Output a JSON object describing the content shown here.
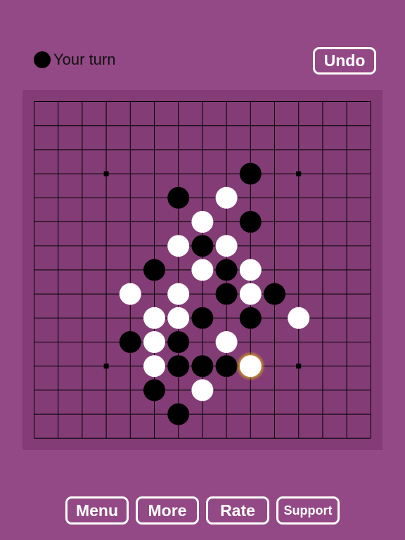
{
  "status": {
    "turn_text": "Your turn",
    "turn_color": "black"
  },
  "toolbar": {
    "undo_label": "Undo"
  },
  "footer": {
    "menu_label": "Menu",
    "more_label": "More",
    "rate_label": "Rate",
    "support_label": "Support"
  },
  "colors": {
    "background": "#934985",
    "board": "#833c75",
    "grid_line": "#000000",
    "black_stone": "#000000",
    "white_stone": "#ffffff",
    "last_move_glow": "#f2c200"
  },
  "board": {
    "size": 15,
    "star_points": [
      [
        3,
        3
      ],
      [
        11,
        3
      ],
      [
        3,
        11
      ],
      [
        11,
        11
      ]
    ],
    "last_move": [
      9,
      11
    ],
    "stones": [
      {
        "col": 9,
        "row": 3,
        "color": "black"
      },
      {
        "col": 6,
        "row": 4,
        "color": "black"
      },
      {
        "col": 8,
        "row": 4,
        "color": "white"
      },
      {
        "col": 7,
        "row": 5,
        "color": "white"
      },
      {
        "col": 9,
        "row": 5,
        "color": "black"
      },
      {
        "col": 6,
        "row": 6,
        "color": "white"
      },
      {
        "col": 7,
        "row": 6,
        "color": "black"
      },
      {
        "col": 8,
        "row": 6,
        "color": "white"
      },
      {
        "col": 5,
        "row": 7,
        "color": "black"
      },
      {
        "col": 7,
        "row": 7,
        "color": "white"
      },
      {
        "col": 8,
        "row": 7,
        "color": "black"
      },
      {
        "col": 9,
        "row": 7,
        "color": "white"
      },
      {
        "col": 4,
        "row": 8,
        "color": "white"
      },
      {
        "col": 6,
        "row": 8,
        "color": "white"
      },
      {
        "col": 8,
        "row": 8,
        "color": "black"
      },
      {
        "col": 9,
        "row": 8,
        "color": "white"
      },
      {
        "col": 10,
        "row": 8,
        "color": "black"
      },
      {
        "col": 5,
        "row": 9,
        "color": "white"
      },
      {
        "col": 6,
        "row": 9,
        "color": "white"
      },
      {
        "col": 7,
        "row": 9,
        "color": "black"
      },
      {
        "col": 9,
        "row": 9,
        "color": "black"
      },
      {
        "col": 11,
        "row": 9,
        "color": "white"
      },
      {
        "col": 4,
        "row": 10,
        "color": "black"
      },
      {
        "col": 5,
        "row": 10,
        "color": "white"
      },
      {
        "col": 6,
        "row": 10,
        "color": "black"
      },
      {
        "col": 8,
        "row": 10,
        "color": "white"
      },
      {
        "col": 5,
        "row": 11,
        "color": "white"
      },
      {
        "col": 6,
        "row": 11,
        "color": "black"
      },
      {
        "col": 7,
        "row": 11,
        "color": "black"
      },
      {
        "col": 8,
        "row": 11,
        "color": "black"
      },
      {
        "col": 9,
        "row": 11,
        "color": "white"
      },
      {
        "col": 5,
        "row": 12,
        "color": "black"
      },
      {
        "col": 7,
        "row": 12,
        "color": "white"
      },
      {
        "col": 6,
        "row": 13,
        "color": "black"
      }
    ]
  }
}
